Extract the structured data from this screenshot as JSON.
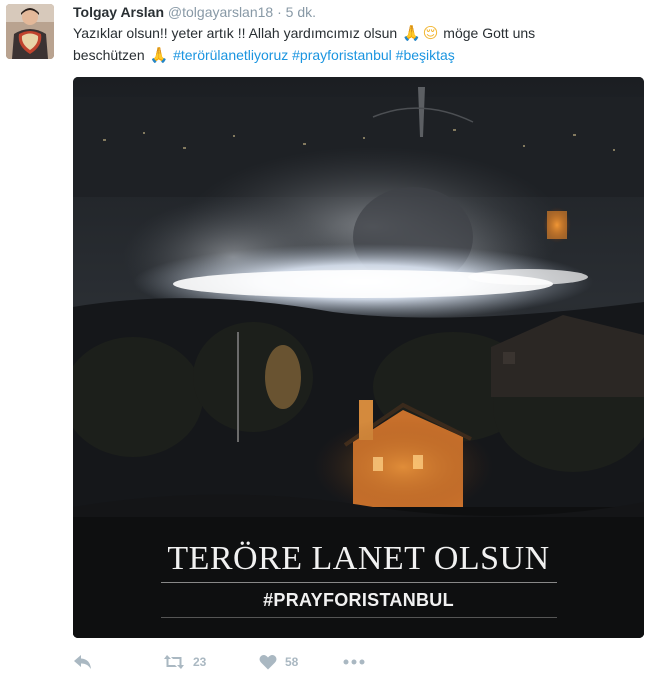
{
  "tweet": {
    "author": {
      "name": "Tolgay Arslan",
      "handle": "@tolgayarslan18",
      "separator": "·",
      "time": "5 dk."
    },
    "text": {
      "line1_a": "Yazıklar olsun!! yeter artık !! Allah yardımcımız olsun ",
      "emoji1": "🙏",
      "emoji2": "😌",
      "line1_b": " möge Gott uns",
      "line2_a": "beschützen ",
      "emoji3": "🙏",
      "hashtags": [
        "#terörülanetliyoruz",
        "#prayforistanbul",
        "#beşiktaş"
      ]
    },
    "media": {
      "headline": "TERÖRE LANET OLSUN",
      "hashtag": "#PRAYFORISTANBUL"
    },
    "actions": {
      "reply_icon": "reply-icon",
      "retweet_icon": "retweet-icon",
      "retweet_count": "23",
      "like_icon": "heart-icon",
      "like_count": "58",
      "more_icon": "more-icon"
    },
    "colors": {
      "link": "#1b95e0",
      "muted": "#8899a6",
      "action": "#aab8c2",
      "text": "#292f33"
    }
  }
}
